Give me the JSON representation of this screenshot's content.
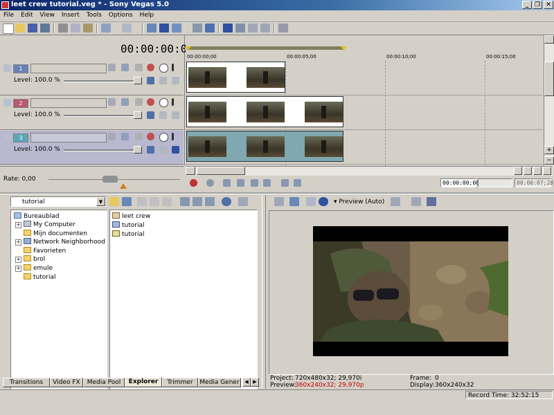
{
  "window": {
    "title": "leet crew tutorial.veg * - Sony Vegas 5.0"
  },
  "menu": [
    "File",
    "Edit",
    "View",
    "Insert",
    "Tools",
    "Options",
    "Help"
  ],
  "timecode": "00:00:00:00",
  "ruler_labels": [
    "00:00:00;00",
    "00:00:05;00",
    "00:00:10;00",
    "00:00:15;00"
  ],
  "tracks": [
    {
      "number": "1",
      "level_label": "Level: 100.0 %",
      "color": "#6b82b8"
    },
    {
      "number": "2",
      "level_label": "Level: 100.0 %",
      "color": "#b85a6b"
    },
    {
      "number": "3",
      "level_label": "Level: 100.0 %",
      "color": "#5aa6b8"
    }
  ],
  "rate_label": "Rate: 0,00",
  "transport": {
    "cursor_time": "00:00:00;00",
    "end_time": "00:00:07;28"
  },
  "explorer": {
    "path": "tutorial",
    "tree": [
      "Bureaublad",
      "My Computer",
      "Mijn documenten",
      "Network Neighborhood",
      "Favorieten",
      "brol",
      "emule",
      "tutorial"
    ],
    "files": [
      "leet crew",
      "tutorial",
      "tutorial"
    ]
  },
  "tabs": [
    "Transitions",
    "Video FX",
    "Media Pool",
    "Explorer",
    "Trimmer",
    "Media Gener"
  ],
  "preview": {
    "mode": "Preview (Auto)",
    "project_label": "Project:",
    "project_value": "720x480x32; 29,970i",
    "preview_label": "Preview:",
    "preview_value": "360x240x32; 29,970p",
    "frame_label": "Frame:",
    "frame_value": "0",
    "display_label": "Display:",
    "display_value": "360x240x32"
  },
  "status": {
    "record_time": "Record Time: 32:52:15"
  },
  "colors": {
    "preview_warning": "#c00000",
    "selected_track": "#b8b8d0"
  }
}
